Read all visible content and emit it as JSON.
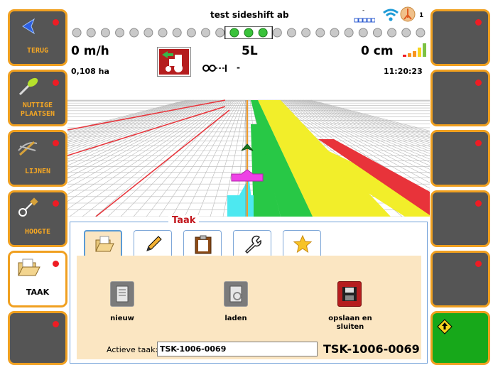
{
  "header": {
    "title": "test sideshift ab",
    "speed": "0 m/h",
    "line_name": "5L",
    "offset": "0 cm",
    "area": "0,108 ha",
    "implement_value": "-",
    "time": "11:20:23",
    "satellite_count": "1",
    "signal_dash": "-",
    "lightbar": {
      "total_dots": 25,
      "active_dots": 3
    }
  },
  "sidebar_left": [
    {
      "label": "TERUG",
      "icon": "back-arrow-icon"
    },
    {
      "label": "NUTTIGE PLAATSEN",
      "icon": "marker-pin-icon"
    },
    {
      "label": "LIJNEN",
      "icon": "lines-icon"
    },
    {
      "label": "HOOGTE",
      "icon": "height-icon"
    },
    {
      "label": "TAAK",
      "icon": "folder-icon",
      "active": true
    },
    {
      "label": "",
      "icon": ""
    }
  ],
  "sidebar_right": [
    {
      "label": ""
    },
    {
      "label": ""
    },
    {
      "label": ""
    },
    {
      "label": ""
    },
    {
      "label": ""
    },
    {
      "label": "",
      "icon": "up-arrow-diamond-icon"
    }
  ],
  "task_panel": {
    "title": "Taak",
    "tabs": [
      {
        "icon": "folder-icon",
        "active": true
      },
      {
        "icon": "pencil-icon"
      },
      {
        "icon": "clipboard-icon"
      },
      {
        "icon": "wrench-icon"
      },
      {
        "icon": "star-icon"
      }
    ],
    "actions": {
      "new_label": "nieuw",
      "load_label": "laden",
      "save_close_label": "opslaan en sluiten"
    },
    "active_task_label": "Actieve taak:",
    "active_task_value": "TSK-1006-0069",
    "active_task_display": "TSK-1006-0069"
  },
  "colors": {
    "accent_orange": "#f0a020",
    "button_gray": "#555555",
    "led_red": "#ee1c24",
    "coverage_yellow": "#f2ee2a",
    "coverage_green": "#28c846",
    "coverage_red": "#e8333a",
    "coverage_cyan": "#4de8f0",
    "panel_title_red": "#c2161c"
  }
}
